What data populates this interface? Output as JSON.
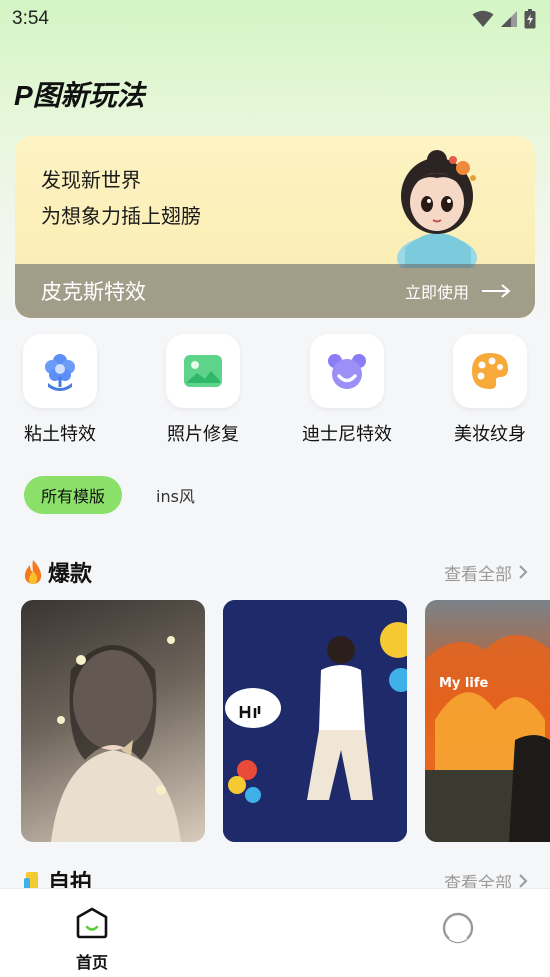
{
  "status": {
    "time": "3:54"
  },
  "page_title": "P图新玩法",
  "banner": {
    "line1": "发现新世界",
    "line2": "为想象力插上翅膀",
    "effect_name": "皮克斯特效",
    "cta": "立即使用"
  },
  "categories": [
    {
      "label": "粘土特效",
      "icon": "flower-icon"
    },
    {
      "label": "照片修复",
      "icon": "image-icon"
    },
    {
      "label": "迪士尼特效",
      "icon": "bear-icon"
    },
    {
      "label": "美妆纹身",
      "icon": "palette-icon"
    }
  ],
  "filters": {
    "active": "所有模版",
    "other": "ins风"
  },
  "sections": {
    "hot": {
      "title": "爆款",
      "see_all": "查看全部"
    },
    "selfie": {
      "title": "自拍",
      "see_all": "查看全部"
    }
  },
  "cards": {
    "card3_text": "My life"
  },
  "nav": {
    "home": "首页"
  },
  "colors": {
    "accent": "#8be06a",
    "top_gradient": "#d3f5c4"
  }
}
